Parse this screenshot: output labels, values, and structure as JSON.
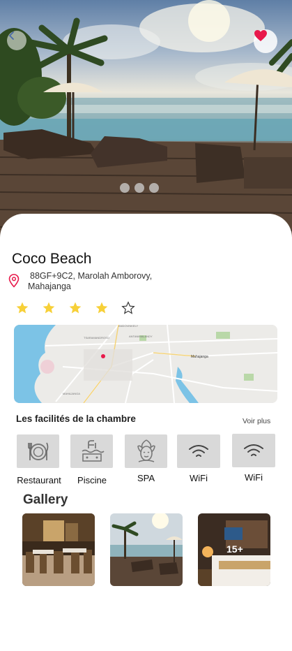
{
  "hero": {
    "carousel_dots": 3
  },
  "hotel": {
    "name": "Coco Beach",
    "address_line1": "88GF+9C2, Marolah Amborovy,",
    "address_line2": "Mahajanga",
    "rating": 4,
    "rating_max": 5
  },
  "facilities": {
    "title": "Les facilités de la chambre",
    "see_more": "Voir plus",
    "items": [
      {
        "label": "Restaurant",
        "icon": "restaurant-icon"
      },
      {
        "label": "Piscine",
        "icon": "pool-icon"
      },
      {
        "label": "SPA",
        "icon": "spa-icon"
      },
      {
        "label": "WiFi",
        "icon": "wifi-icon"
      },
      {
        "label": "WiFi",
        "icon": "wifi-icon"
      }
    ]
  },
  "gallery": {
    "title": "Gallery",
    "more_count": "15+"
  },
  "colors": {
    "heart": "#e8194b",
    "star": "#f7d038",
    "pin": "#e8194b",
    "facility_bg": "#d9d9d9"
  }
}
